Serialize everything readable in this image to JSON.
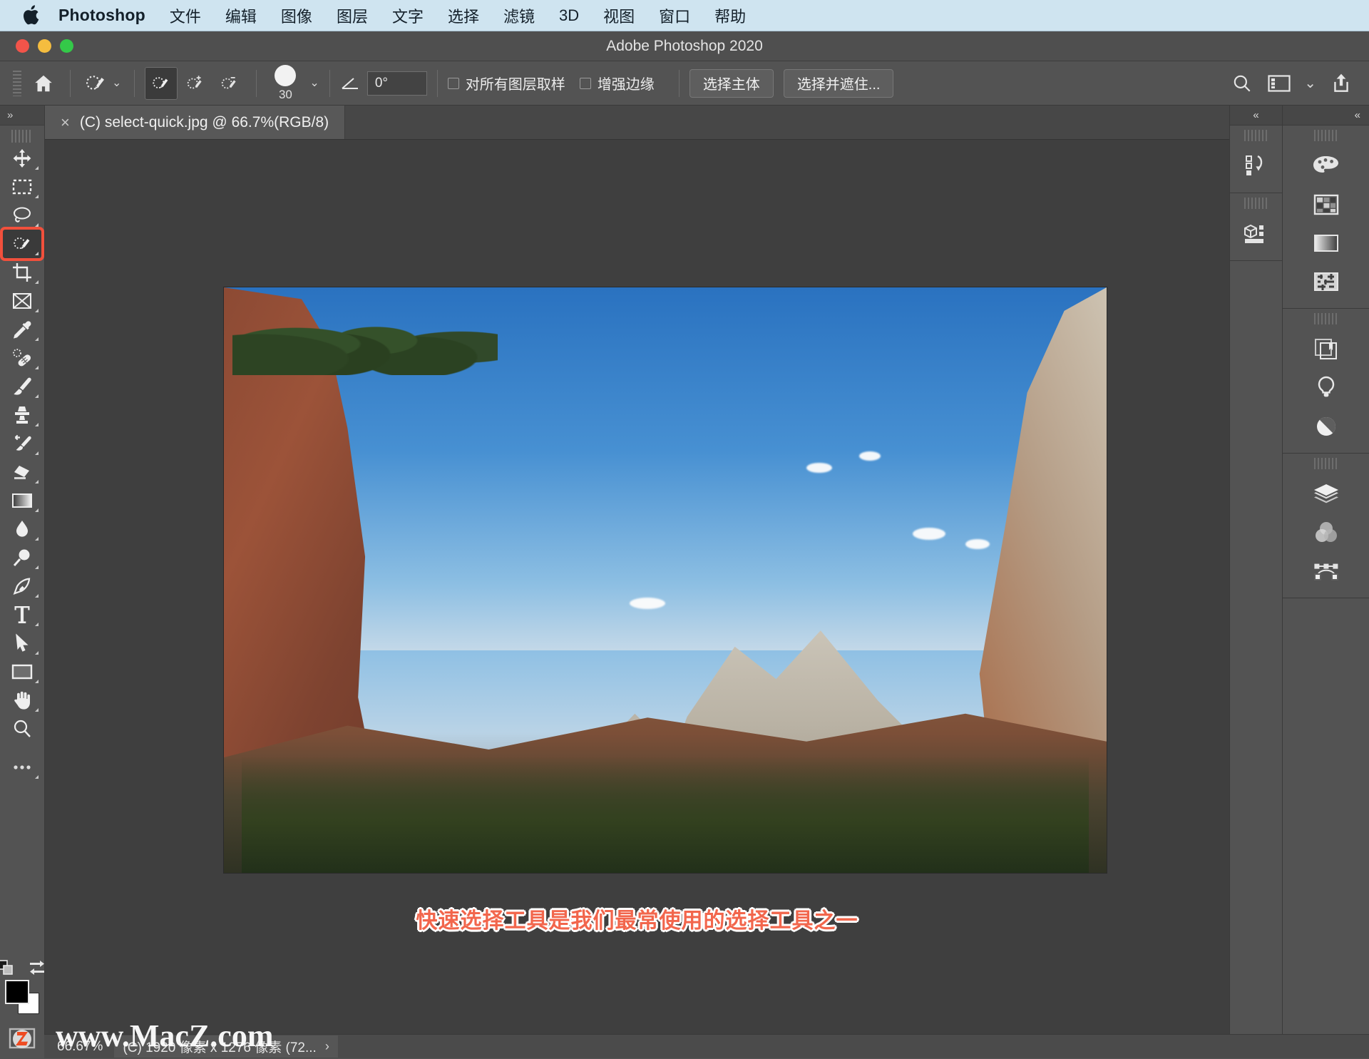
{
  "menubar": {
    "app_logo": "apple-logo",
    "app_name": "Photoshop",
    "items": [
      "文件",
      "编辑",
      "图像",
      "图层",
      "文字",
      "选择",
      "滤镜",
      "3D",
      "视图",
      "窗口",
      "帮助"
    ]
  },
  "window": {
    "title": "Adobe Photoshop 2020"
  },
  "options_bar": {
    "home_icon": "home-icon",
    "tool_preset_icon": "quick-selection-tool-icon",
    "mode_new": "selection-new-icon",
    "mode_add": "selection-add-icon",
    "mode_subtract": "selection-subtract-icon",
    "brush_size": "30",
    "angle_icon": "angle-icon",
    "angle_value": "0°",
    "sample_all_layers_label": "对所有图层取样",
    "enhance_edge_label": "增强边缘",
    "select_subject_label": "选择主体",
    "select_and_mask_label": "选择并遮住...",
    "search_icon": "search-icon",
    "workspace_icon": "workspace-icon",
    "workspace_chevron": "chevron-down-icon",
    "share_icon": "share-icon"
  },
  "toolbar": {
    "collapse_label": "»",
    "tools": [
      {
        "name": "move-tool",
        "icon": "move-icon"
      },
      {
        "name": "rectangular-marquee-tool",
        "icon": "marquee-icon"
      },
      {
        "name": "lasso-tool",
        "icon": "lasso-icon"
      },
      {
        "name": "quick-selection-tool",
        "icon": "quick-selection-icon",
        "selected": true
      },
      {
        "name": "crop-tool",
        "icon": "crop-icon"
      },
      {
        "name": "frame-tool",
        "icon": "frame-icon"
      },
      {
        "name": "eyedropper-tool",
        "icon": "eyedropper-icon"
      },
      {
        "name": "healing-brush-tool",
        "icon": "healing-brush-icon"
      },
      {
        "name": "brush-tool",
        "icon": "brush-icon"
      },
      {
        "name": "clone-stamp-tool",
        "icon": "clone-stamp-icon"
      },
      {
        "name": "history-brush-tool",
        "icon": "history-brush-icon"
      },
      {
        "name": "eraser-tool",
        "icon": "eraser-icon"
      },
      {
        "name": "gradient-tool",
        "icon": "gradient-icon"
      },
      {
        "name": "blur-tool",
        "icon": "blur-drop-icon"
      },
      {
        "name": "dodge-tool",
        "icon": "dodge-icon"
      },
      {
        "name": "pen-tool",
        "icon": "pen-icon"
      },
      {
        "name": "type-tool",
        "icon": "type-t-icon"
      },
      {
        "name": "path-selection-tool",
        "icon": "path-arrow-icon"
      },
      {
        "name": "rectangle-tool",
        "icon": "rectangle-icon"
      },
      {
        "name": "hand-tool",
        "icon": "hand-icon"
      },
      {
        "name": "zoom-tool",
        "icon": "zoom-magnifier-icon"
      },
      {
        "name": "edit-toolbar",
        "icon": "ellipsis-icon"
      }
    ],
    "quick-mask-icon": "quick-mask-icon",
    "screen-mode-icon": "screen-mode-icon",
    "foreground_color": "#000000",
    "background_color": "#ffffff",
    "footer_icon": "z-logo-icon"
  },
  "document": {
    "tab_title": "(C) select-quick.jpg @ 66.7%(RGB/8)",
    "tab_close": "×"
  },
  "canvas": {
    "caption_text": "快速选择工具是我们最常使用的选择工具之一",
    "caption_color": "#f2664c"
  },
  "panels": {
    "collapse_left": "«",
    "collapse_right": "«",
    "left_rail": [
      {
        "name": "history-panel-icon",
        "icon": "history-icon"
      },
      {
        "name": "3d-panel-icon",
        "icon": "cube-icon"
      }
    ],
    "right_rail_group1": [
      {
        "name": "color-panel-icon",
        "icon": "palette-icon"
      },
      {
        "name": "swatches-panel-icon",
        "icon": "grid-swatches-icon"
      },
      {
        "name": "gradients-panel-icon",
        "icon": "gradient-swatch-icon"
      },
      {
        "name": "patterns-panel-icon",
        "icon": "pattern-icon"
      }
    ],
    "right_rail_group2": [
      {
        "name": "libraries-panel-icon",
        "icon": "library-icon"
      },
      {
        "name": "learn-panel-icon",
        "icon": "bulb-icon"
      },
      {
        "name": "adjustments-panel-icon",
        "icon": "half-circle-icon"
      }
    ],
    "right_rail_group3": [
      {
        "name": "layers-panel-icon",
        "icon": "layers-icon"
      },
      {
        "name": "channels-panel-icon",
        "icon": "channels-icon"
      },
      {
        "name": "paths-panel-icon",
        "icon": "paths-icon"
      }
    ]
  },
  "statusbar": {
    "zoom_level": "66.67%",
    "doc_info": "(C) 1920 像素 x 1276 像素 (72...",
    "expand_arrow": "›"
  },
  "watermark": {
    "text": "www.MacZ.com"
  }
}
